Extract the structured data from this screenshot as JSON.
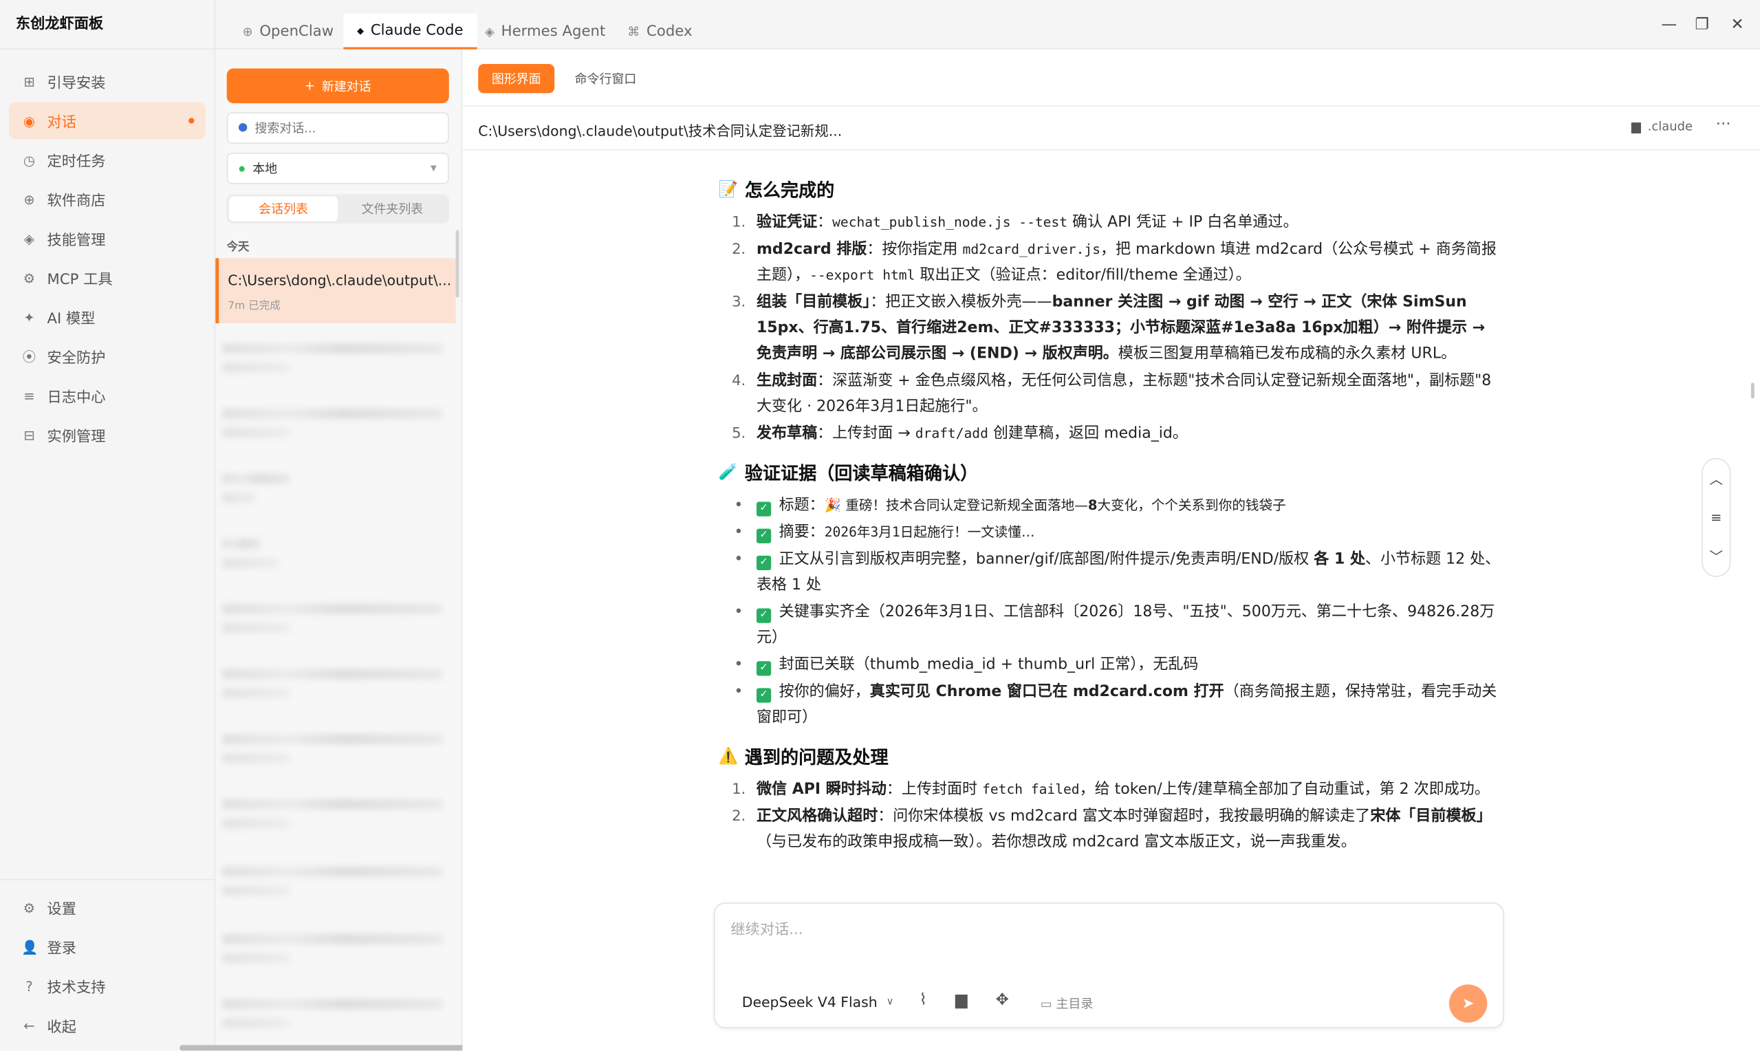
{
  "app": {
    "title": "东创龙虾面板"
  },
  "nav": {
    "items": [
      {
        "label": "引导安装",
        "icon": "grid-icon",
        "glyph": "⊞"
      },
      {
        "label": "对话",
        "icon": "chat-icon",
        "glyph": "◉"
      },
      {
        "label": "定时任务",
        "icon": "clock-icon",
        "glyph": "◷"
      },
      {
        "label": "软件商店",
        "icon": "store-icon",
        "glyph": "⊕"
      },
      {
        "label": "技能管理",
        "icon": "skill-icon",
        "glyph": "◈"
      },
      {
        "label": "MCP 工具",
        "icon": "gear-icon",
        "glyph": "⚙"
      },
      {
        "label": "AI 模型",
        "icon": "ai-icon",
        "glyph": "✦"
      },
      {
        "label": "安全防护",
        "icon": "shield-icon",
        "glyph": "⦿"
      },
      {
        "label": "日志中心",
        "icon": "list-icon",
        "glyph": "≡"
      },
      {
        "label": "实例管理",
        "icon": "instance-icon",
        "glyph": "⊟"
      }
    ],
    "bottom": [
      {
        "label": "设置",
        "glyph": "⚙"
      },
      {
        "label": "登录",
        "glyph": "👤"
      },
      {
        "label": "技术支持",
        "glyph": "?"
      },
      {
        "label": "收起",
        "glyph": "←"
      }
    ]
  },
  "tabs": [
    {
      "label": "OpenClaw",
      "glyph": "⊕"
    },
    {
      "label": "Claude Code",
      "glyph": "◆"
    },
    {
      "label": "Hermes Agent",
      "glyph": "◈"
    },
    {
      "label": "Codex",
      "glyph": "⌘"
    }
  ],
  "window": {
    "min": "—",
    "max": "❐",
    "close": "✕"
  },
  "sessions": {
    "new_label": "新建对话",
    "new_glyph": "+",
    "search_placeholder": "搜索对话...",
    "location": "本地",
    "seg_sessions": "会话列表",
    "seg_folders": "文件夹列表",
    "day": "今天",
    "current_title": "C:\\Users\\dong\\.claude\\output\\...",
    "current_meta": "7m  已完成"
  },
  "main": {
    "mode_gui": "图形界面",
    "mode_cli": "命令行窗口",
    "path": "C:\\Users\\dong\\.claude\\output\\技术合同认定登记新规...",
    "path_tag": ".claude",
    "more": "···"
  },
  "content": {
    "h1": "怎么完成的",
    "h2": "验证证据（回读草稿箱确认）",
    "h3": "遇到的问题及处理"
  },
  "composer": {
    "placeholder": "继续对话...",
    "model": "DeepSeek V4 Flash",
    "home": "主目录"
  }
}
